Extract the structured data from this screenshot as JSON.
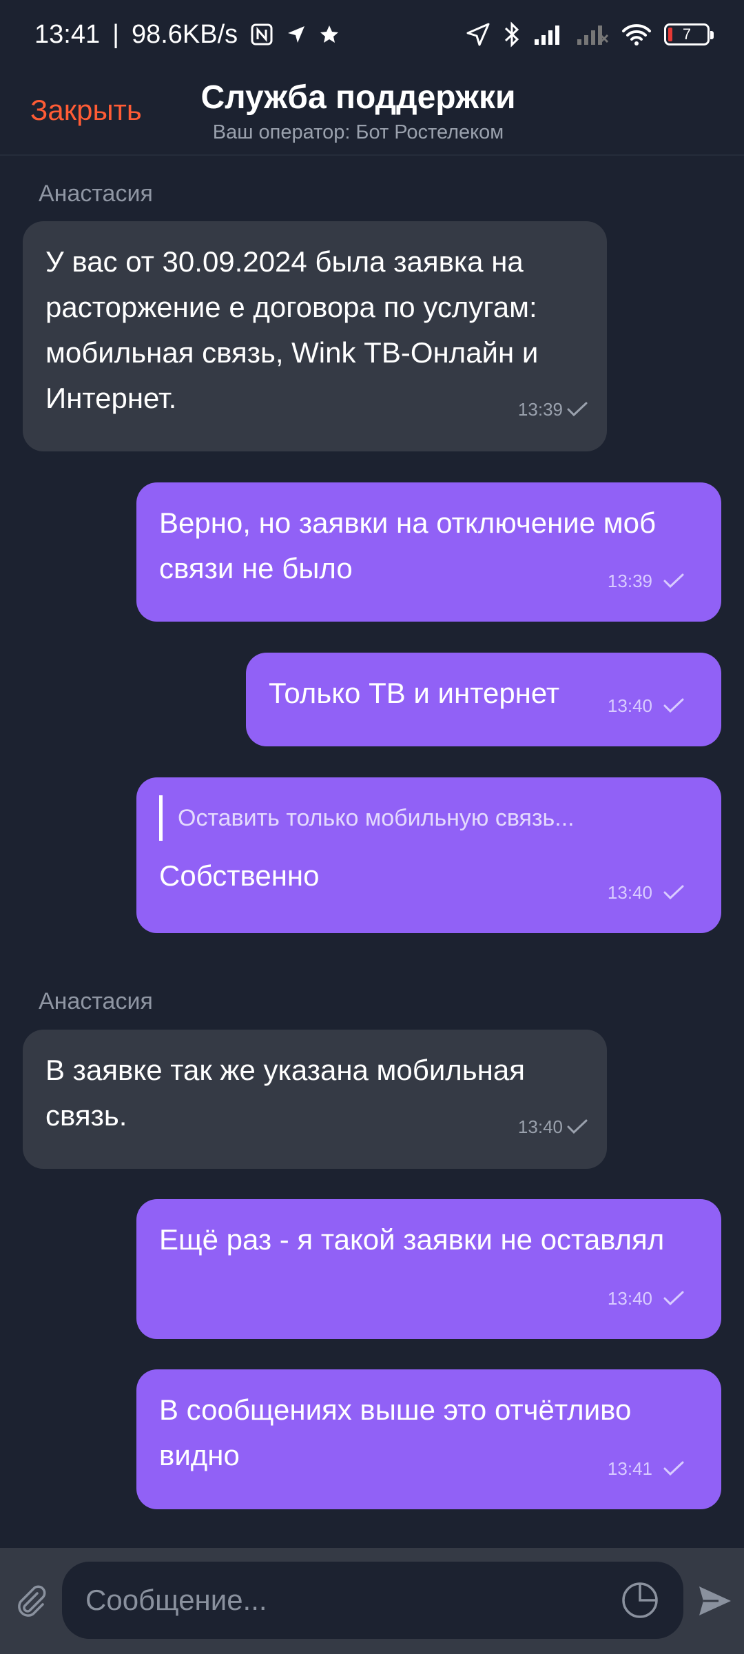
{
  "status_bar": {
    "time": "13:41",
    "separator": "|",
    "speed": "98.6KB/s",
    "battery_level": "7",
    "icons": [
      "nfc-icon",
      "location-arrow-icon",
      "star-icon",
      "gps-icon",
      "bluetooth-icon",
      "signal-icon",
      "signal-off-icon",
      "wifi-icon",
      "battery-icon"
    ]
  },
  "header": {
    "close_label": "Закрыть",
    "title": "Служба поддержки",
    "subtitle": "Ваш оператор: Бот Ростелеком"
  },
  "messages": [
    {
      "sender": "Анастасия",
      "direction": "in",
      "text": "У вас от 30.09.2024 была заявка на расторжение е договора по услугам: мобильная связь, Wink ТВ-Онлайн и Интернет.",
      "time": "13:39"
    },
    {
      "direction": "out",
      "text": "Верно, но заявки на отключение моб связи не было",
      "time": "13:39"
    },
    {
      "direction": "out",
      "text": "Только ТВ и интернет",
      "time": "13:40"
    },
    {
      "direction": "out",
      "quote": "Оставить только мобильную связь...",
      "text": "Собственно",
      "time": "13:40"
    },
    {
      "sender": "Анастасия",
      "direction": "in",
      "text": "В заявке так же указана мобильная связь.",
      "time": "13:40"
    },
    {
      "direction": "out",
      "text": "Ещё раз - я такой заявки не оставлял",
      "time": "13:40"
    },
    {
      "direction": "out",
      "text": "В сообщениях выше это отчётливо видно",
      "time": "13:41"
    }
  ],
  "input": {
    "placeholder": "Сообщение..."
  },
  "colors": {
    "background": "#1c2230",
    "incoming_bubble": "#353a45",
    "outgoing_bubble": "#9161f6",
    "accent": "#ff5c35"
  }
}
